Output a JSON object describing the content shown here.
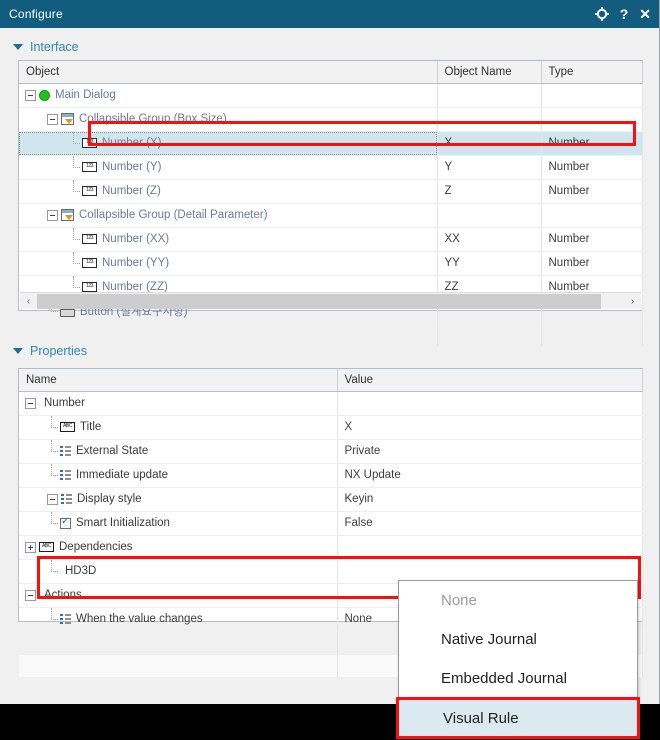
{
  "window": {
    "title": "Configure",
    "titlebar_icons": [
      {
        "name": "gear-icon",
        "glyph": "⚙"
      },
      {
        "name": "help-icon",
        "glyph": "?"
      },
      {
        "name": "close-icon",
        "glyph": "✕"
      }
    ],
    "accent_color": "#125c80",
    "section_label_color": "#2f87ad",
    "highlight_color": "#fa0f0f",
    "selection_color": "#cfe6ef"
  },
  "interface": {
    "section_label": "Interface",
    "columns": [
      "Object",
      "Object Name",
      "Type"
    ],
    "rows": [
      {
        "object": "Main Dialog",
        "name": "",
        "type": "",
        "icon": "dialog-icon",
        "depth": 0,
        "expander": "minus",
        "selected": false
      },
      {
        "object": "Collapsible Group (Box Size)",
        "name": "",
        "type": "",
        "icon": "group-icon",
        "depth": 1,
        "expander": "minus",
        "selected": false
      },
      {
        "object": "Number (X)",
        "name": "X",
        "type": "Number",
        "icon": "number-icon",
        "depth": 2,
        "expander": "none",
        "selected": true
      },
      {
        "object": "Number (Y)",
        "name": "Y",
        "type": "Number",
        "icon": "number-icon",
        "depth": 2,
        "expander": "none",
        "selected": false
      },
      {
        "object": "Number (Z)",
        "name": "Z",
        "type": "Number",
        "icon": "number-icon",
        "depth": 2,
        "expander": "none",
        "selected": false
      },
      {
        "object": "Collapsible Group (Detail Parameter)",
        "name": "",
        "type": "",
        "icon": "group-icon",
        "depth": 1,
        "expander": "minus",
        "selected": false
      },
      {
        "object": "Number (XX)",
        "name": "XX",
        "type": "Number",
        "icon": "number-icon",
        "depth": 2,
        "expander": "none",
        "selected": false
      },
      {
        "object": "Number (YY)",
        "name": "YY",
        "type": "Number",
        "icon": "number-icon",
        "depth": 2,
        "expander": "none",
        "selected": false
      },
      {
        "object": "Number (ZZ)",
        "name": "ZZ",
        "type": "Number",
        "icon": "number-icon",
        "depth": 2,
        "expander": "none",
        "selected": false
      },
      {
        "object": "Button (설계요구사항)",
        "name": "",
        "type": "",
        "icon": "button-icon",
        "depth": 1,
        "expander": "none",
        "selected": false
      }
    ],
    "scrollbar": {
      "left_arrow": "‹",
      "right_arrow": "›"
    }
  },
  "properties": {
    "section_label": "Properties",
    "columns": [
      "Name",
      "Value"
    ],
    "rows": [
      {
        "name": "Number",
        "value": "",
        "icon": "none",
        "depth": 0,
        "expander": "minus",
        "highlight": false
      },
      {
        "name": "Title",
        "value": "X",
        "icon": "abc-icon",
        "depth": 1,
        "expander": "none",
        "highlight": false
      },
      {
        "name": "External State",
        "value": "Private",
        "icon": "list-icon",
        "depth": 1,
        "expander": "none",
        "highlight": false
      },
      {
        "name": "Immediate update",
        "value": "NX Update",
        "icon": "list-icon",
        "depth": 1,
        "expander": "none",
        "highlight": false
      },
      {
        "name": "Display style",
        "value": "Keyin",
        "icon": "list-icon",
        "depth": 1,
        "expander": "minus",
        "highlight": false
      },
      {
        "name": "Smart Initialization",
        "value": "False",
        "icon": "check-icon",
        "depth": 1,
        "expander": "none",
        "highlight": false
      },
      {
        "name": "Dependencies",
        "value": "",
        "icon": "abc-icon",
        "depth": 0,
        "expander": "plus",
        "highlight": false
      },
      {
        "name": "HD3D",
        "value": "",
        "icon": "none",
        "depth": 1,
        "expander": "none",
        "highlight": false
      },
      {
        "name": "Actions",
        "value": "",
        "icon": "none",
        "depth": 0,
        "expander": "minus",
        "highlight": true
      },
      {
        "name": "When the value changes",
        "value": "None",
        "icon": "list-icon",
        "depth": 1,
        "expander": "none",
        "highlight": true
      }
    ]
  },
  "dropdown_menu": {
    "items": [
      {
        "label": "None",
        "disabled": true,
        "selected": false
      },
      {
        "label": "Native Journal",
        "disabled": false,
        "selected": false
      },
      {
        "label": "Embedded Journal",
        "disabled": false,
        "selected": false
      },
      {
        "label": "Visual Rule",
        "disabled": false,
        "selected": true
      }
    ]
  }
}
